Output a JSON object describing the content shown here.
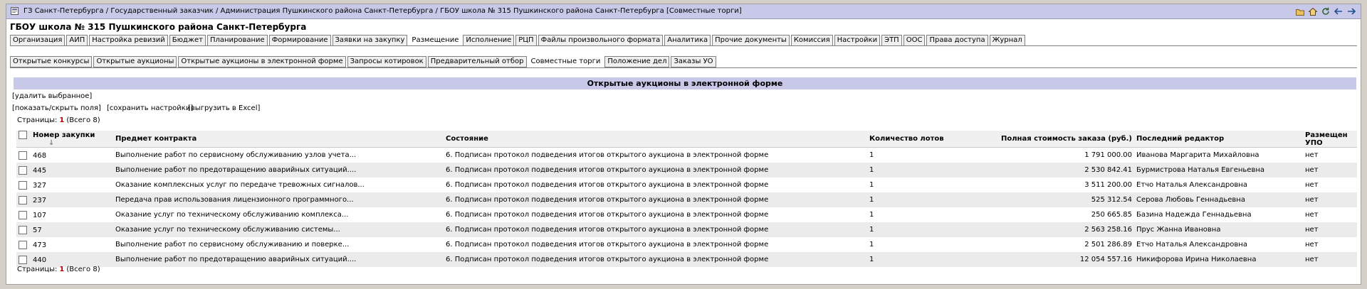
{
  "breadcrumb": "ГЗ Санкт-Петербурга / Государственный заказчик / Администрация Пушкинского района Санкт-Петербурга / ГБОУ школа № 315 Пушкинского района Санкт-Петербурга [Совместные торги]",
  "org_title": "ГБОУ школа № 315 Пушкинского района Санкт-Петербурга",
  "tabs_main": [
    "Организация",
    "АИП",
    "Настройка ревизий",
    "Бюджет",
    "Планирование",
    "Формирование",
    "Заявки на закупку",
    "Размещение",
    "Исполнение",
    "РЦП",
    "Файлы произвольного формата",
    "Аналитика",
    "Прочие документы",
    "Комиссия",
    "Настройки",
    "ЭТП",
    "ООС",
    "Права доступа",
    "Журнал"
  ],
  "tabs_sub": [
    "Открытые конкурсы",
    "Открытые аукционы",
    "Открытые аукционы в электронной форме",
    "Запросы котировок",
    "Предварительный отбор",
    "Совместные торги",
    "Положение дел",
    "Заказы УО"
  ],
  "section_title": "Открытые аукционы в электронной форме",
  "actions": {
    "delete": "[удалить выбранное]",
    "toggle_fields": "[показать/скрыть поля]",
    "save_settings": "[сохранить настройки]",
    "export_excel": "[выгрузить в Excel]"
  },
  "paging": {
    "label": "Страницы:",
    "current": "1",
    "total": "(Всего 8)"
  },
  "columns": [
    "Номер закупки",
    "Предмет контракта",
    "Состояние",
    "Количество лотов",
    "Полная стоимость заказа (руб.)",
    "Последний редактор",
    "Размещен УПО"
  ],
  "rows": [
    {
      "num": "468",
      "subject": "Выполнение работ по сервисному обслуживанию узлов учета...",
      "state": "6. Подписан протокол подведения итогов открытого аукциона в электронной форме",
      "lots": "1",
      "cost": "1 791 000.00",
      "editor": "Иванова Маргарита Михайловна",
      "upo": "нет"
    },
    {
      "num": "445",
      "subject": "Выполнение работ по предотвращению аварийных ситуаций....",
      "state": "6. Подписан протокол подведения итогов открытого аукциона в электронной форме",
      "lots": "1",
      "cost": "2 530 842.41",
      "editor": "Бурмистрова Наталья Евгеньевна",
      "upo": "нет"
    },
    {
      "num": "327",
      "subject": "Оказание комплексных услуг по передаче тревожных сигналов...",
      "state": "6. Подписан протокол подведения итогов открытого аукциона в электронной форме",
      "lots": "1",
      "cost": "3 511 200.00",
      "editor": "Етчо Наталья Александровна",
      "upo": "нет"
    },
    {
      "num": "237",
      "subject": "Передача прав использования лицензионного программного...",
      "state": "6. Подписан протокол подведения итогов открытого аукциона в электронной форме",
      "lots": "1",
      "cost": "525 312.54",
      "editor": "Серова Любовь Геннадьевна",
      "upo": "нет"
    },
    {
      "num": "107",
      "subject": "Оказание услуг по техническому обслуживанию комплекса...",
      "state": "6. Подписан протокол подведения итогов открытого аукциона в электронной форме",
      "lots": "1",
      "cost": "250 665.85",
      "editor": "Базина Надежда Геннадьевна",
      "upo": "нет"
    },
    {
      "num": "57",
      "subject": "Оказание услуг по техническому обслуживанию системы...",
      "state": "6. Подписан протокол подведения итогов открытого аукциона в электронной форме",
      "lots": "1",
      "cost": "2 563 258.16",
      "editor": "Прус Жанна Ивановна",
      "upo": "нет"
    },
    {
      "num": "473",
      "subject": "Выполнение работ по сервисному обслуживанию и поверке...",
      "state": "6. Подписан протокол подведения итогов открытого аукциона в электронной форме",
      "lots": "1",
      "cost": "2 501 286.89",
      "editor": "Етчо Наталья Александровна",
      "upo": "нет"
    },
    {
      "num": "440",
      "subject": "Выполнение работ по предотвращению аварийных ситуаций....",
      "state": "6. Подписан протокол подведения итогов открытого аукциона в электронной форме",
      "lots": "1",
      "cost": "12 054 557.16",
      "editor": "Никифорова Ирина Николаевна",
      "upo": "нет"
    }
  ],
  "icons": [
    "folder-icon",
    "home-icon",
    "refresh-icon",
    "back-arrow-icon",
    "forward-arrow-icon"
  ],
  "colors": {
    "header_bg": "#c8c8e8",
    "page_num": "#c00000",
    "row_alt": "#ebebeb"
  }
}
